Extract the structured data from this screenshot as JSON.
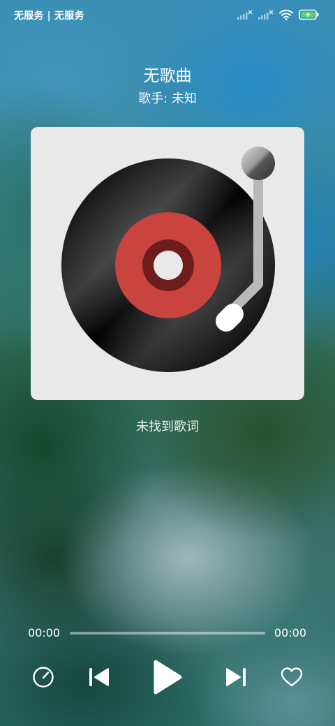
{
  "status_bar": {
    "carrier": "无服务 | 无服务",
    "icons": [
      "signal-no-service-icon",
      "signal-no-service-icon",
      "wifi-icon",
      "battery-charging-icon"
    ]
  },
  "player": {
    "title": "无歌曲",
    "artist_label": "歌手",
    "artist": "未知",
    "artist_line": "歌手: 未知",
    "cover_icon": "vinyl-turntable-icon",
    "lyrics_status": "未找到歌词"
  },
  "progress": {
    "current_time": "00:00",
    "total_time": "00:00",
    "fraction": 0
  },
  "controls": {
    "speed": "speed-gauge-icon",
    "previous": "skip-previous-icon",
    "play": "play-icon",
    "next": "skip-next-icon",
    "favorite": "heart-outline-icon"
  },
  "colors": {
    "record_label": "#c9433f",
    "record_label_inner": "#6e1d1d",
    "card_background": "#e9e9e9",
    "progress_track": "rgba(255,255,255,0.45)"
  }
}
